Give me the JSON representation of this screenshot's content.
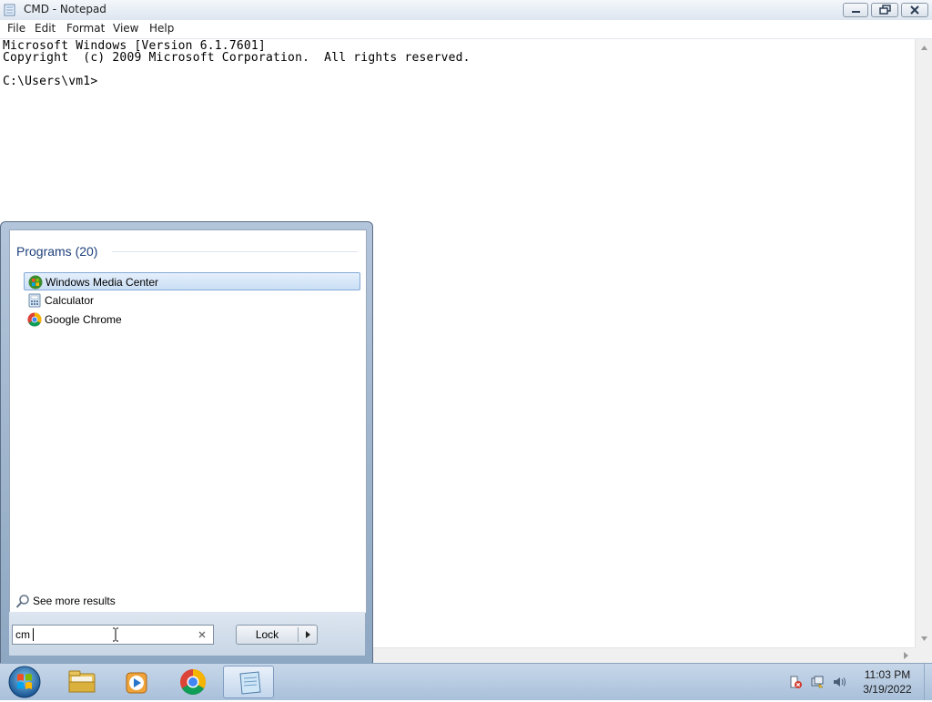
{
  "window": {
    "title": "CMD - Notepad",
    "icon": "notepad-icon"
  },
  "menubar": {
    "items": [
      "File",
      "Edit",
      "Format",
      "View",
      "Help"
    ]
  },
  "editor": {
    "lines": [
      "Microsoft Windows [Version 6.1.7601]",
      "Copyright  (c) 2009 Microsoft Corporation.  All rights reserved.",
      "",
      "C:\\Users\\vm1>"
    ]
  },
  "start_menu": {
    "group_title": "Programs (20)",
    "results": [
      {
        "label": "Windows Media Center",
        "icon": "windows-media-center-icon",
        "selected": true
      },
      {
        "label": "Calculator",
        "icon": "calculator-icon",
        "selected": false
      },
      {
        "label": "Google Chrome",
        "icon": "chrome-icon",
        "selected": false
      }
    ],
    "see_more": "See more results",
    "search": {
      "value": "cm",
      "placeholder": ""
    },
    "lock_label": "Lock"
  },
  "taskbar": {
    "pinned": [
      "windows-explorer-icon",
      "media-player-icon",
      "chrome-icon",
      "notepad-icon"
    ],
    "active": "notepad-icon",
    "tray": [
      "action-center-icon",
      "network-icon",
      "volume-icon"
    ],
    "time": "11:03 PM",
    "date": "3/19/2022"
  },
  "colors": {
    "title_text": "#1e1e1e",
    "group_title": "#1d3f7a",
    "selected_bg": "#c9def5",
    "taskbar": "#b5c9e0"
  }
}
